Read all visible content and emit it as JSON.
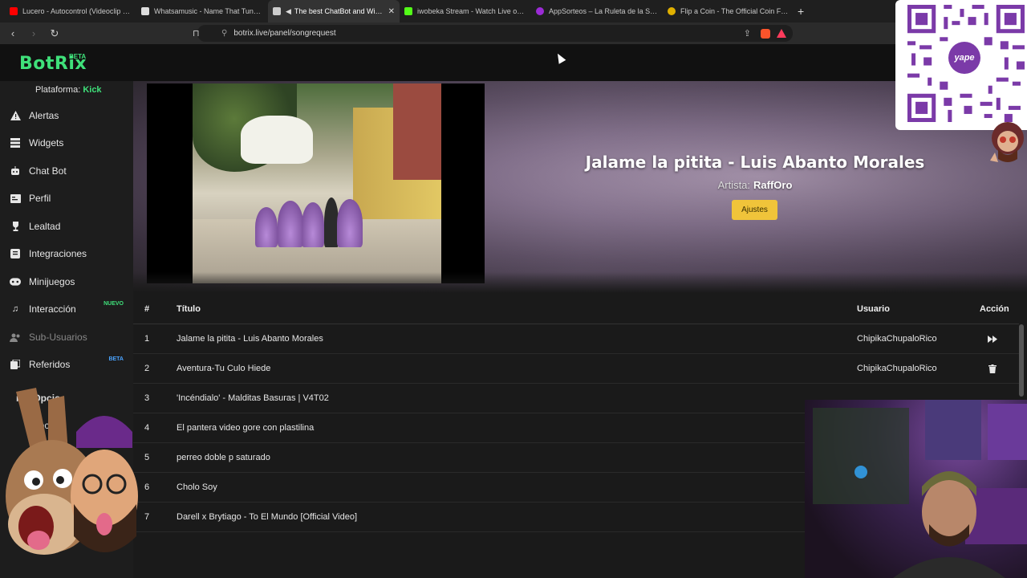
{
  "browser": {
    "tabs": [
      {
        "title": "Lucero - Autocontrol (Videoclip Resto",
        "color": "#ff0000",
        "active": false
      },
      {
        "title": "Whatsamusic - Name That Tune, Gue",
        "color": "#dddddd",
        "active": false
      },
      {
        "title": "The best ChatBot and Widge",
        "color": "#cccccc",
        "active": true
      },
      {
        "title": "iwobeka Stream - Watch Live on Kick",
        "color": "#53fc18",
        "active": false
      },
      {
        "title": "AppSorteos – La Ruleta de la Suerte",
        "color": "#9b2bd6",
        "active": false
      },
      {
        "title": "Flip a Coin - The Official Coin Flip Ga",
        "color": "#e0b000",
        "active": false
      }
    ],
    "url": "botrix.live/panel/songrequest"
  },
  "header": {
    "logo": "BotRix",
    "beta": "BETA"
  },
  "sidebar": {
    "platform_label": "Plataforma:",
    "platform_value": "Kick",
    "items": [
      {
        "label": "Alertas",
        "icon": "warning-icon"
      },
      {
        "label": "Widgets",
        "icon": "grid-icon"
      },
      {
        "label": "Chat Bot",
        "icon": "robot-icon"
      },
      {
        "label": "Perfil",
        "icon": "id-card-icon"
      },
      {
        "label": "Lealtad",
        "icon": "trophy-icon"
      },
      {
        "label": "Integraciones",
        "icon": "plug-icon"
      },
      {
        "label": "Minijuegos",
        "icon": "gamepad-icon"
      },
      {
        "label": "Interacción",
        "icon": "music-icon",
        "tag": "NUEVO"
      },
      {
        "label": "Sub-Usuarios",
        "icon": "users-icon"
      },
      {
        "label": "Referidos",
        "icon": "share-icon",
        "tag": "BETA"
      }
    ],
    "extra_partial": "ras Opcio",
    "extra_partial2": "Doc"
  },
  "now_playing": {
    "title": "Jalame la pitita - Luis Abanto Morales",
    "artist_label": "Artista:",
    "artist": "RaffOro",
    "settings_button": "Ajustes"
  },
  "queue": {
    "headers": {
      "num": "#",
      "title": "Título",
      "user": "Usuario",
      "action": "Acción"
    },
    "rows": [
      {
        "num": "1",
        "title": "Jalame la pitita - Luis Abanto Morales",
        "user": "ChipikaChupaloRico",
        "action": "skip-icon"
      },
      {
        "num": "2",
        "title": "Aventura-Tu Culo Hiede",
        "user": "ChipikaChupaloRico",
        "action": "trash-icon"
      },
      {
        "num": "3",
        "title": "'Incéndialo' - Malditas Basuras | V4T02",
        "user": "",
        "action": ""
      },
      {
        "num": "4",
        "title": "El pantera video gore con plastilina",
        "user": "",
        "action": ""
      },
      {
        "num": "5",
        "title": "perreo doble p saturado",
        "user": "",
        "action": ""
      },
      {
        "num": "6",
        "title": "Cholo Soy",
        "user": "",
        "action": ""
      },
      {
        "num": "7",
        "title": "Darell x Brytiago - To El Mundo [Official Video]",
        "user": "",
        "action": ""
      }
    ]
  },
  "overlay": {
    "yape_label": "yape"
  },
  "colors": {
    "brand": "#3fe07a",
    "button": "#f0c43a",
    "nuevo": "#3fe07a",
    "beta": "#4aa3ff"
  }
}
